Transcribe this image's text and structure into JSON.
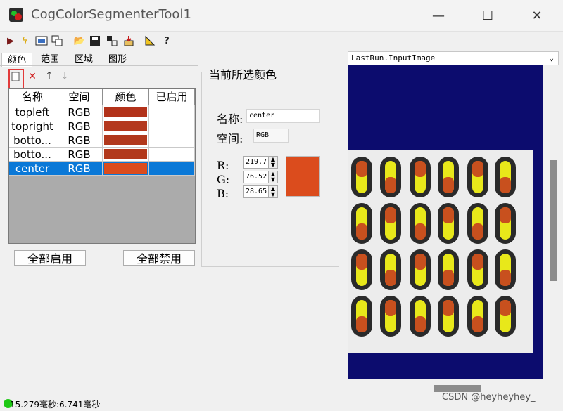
{
  "window": {
    "title": "CogColorSegmenterTool1"
  },
  "toolbar": {
    "icons": [
      "run-icon",
      "electric-icon",
      "image-icon",
      "copy-icon",
      "open-icon",
      "save-icon",
      "export-icon",
      "import-icon",
      "ruler-icon",
      "help-icon"
    ]
  },
  "tabs": [
    {
      "label": "颜色",
      "active": true
    },
    {
      "label": "范围",
      "active": false
    },
    {
      "label": "区域",
      "active": false
    },
    {
      "label": "图形",
      "active": false
    }
  ],
  "table": {
    "headers": [
      "名称",
      "空间",
      "颜色",
      "已启用"
    ],
    "rows": [
      {
        "name": "topleft",
        "space": "RGB",
        "color": "#b2321a",
        "selected": false
      },
      {
        "name": "topright",
        "space": "RGB",
        "color": "#b4381e",
        "selected": false
      },
      {
        "name": "botto...",
        "space": "RGB",
        "color": "#b1381c",
        "selected": false
      },
      {
        "name": "botto...",
        "space": "RGB",
        "color": "#b2391c",
        "selected": false
      },
      {
        "name": "center",
        "space": "RGB",
        "color": "#db4c1d",
        "selected": true
      }
    ]
  },
  "buttons": {
    "enable_all": "全部启用",
    "disable_all": "全部禁用"
  },
  "current_color": {
    "group_title": "当前所选颜色",
    "name_label": "名称:",
    "name_value": "center",
    "space_label": "空间:",
    "space_value": "RGB",
    "r_label": "R:",
    "r_value": "219.7",
    "g_label": "G:",
    "g_value": "76.52",
    "b_label": "B:",
    "b_value": "28.65",
    "swatch_color": "#db4c1d"
  },
  "image_panel": {
    "selector": "LastRun.InputImage",
    "background": "#0c0c6e"
  },
  "status": {
    "text": "15.279毫秒:6.741毫秒"
  },
  "watermark": "CSDN @heyheyhey_"
}
